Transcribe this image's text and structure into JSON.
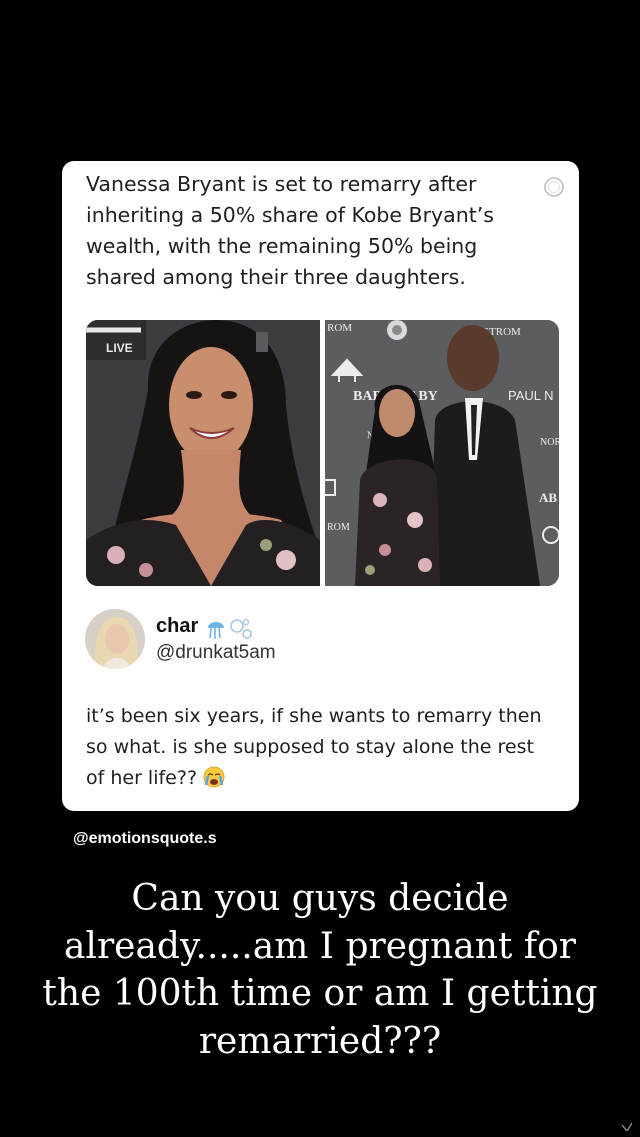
{
  "post": {
    "headline": "Vanessa Bryant is set to remarry after inheriting a 50% share of Kobe Bryant’s wealth, with the remaining 50% being shared among their three daughters.",
    "photo_left": {
      "backdrop_text": "LIVE"
    },
    "photo_right": {
      "backdrop_texts": [
        "ROM",
        "DSTROM",
        "BABY2BABY",
        "PAUL N",
        "NOR",
        "AB",
        "ROM",
        "N"
      ]
    }
  },
  "reply": {
    "user_name": "char",
    "user_handle": "@drunkat5am",
    "text": "it’s been six years, if she wants to remarry then so what. is she supposed to stay alone the rest of her life??",
    "emoji": "crying-face"
  },
  "watermark": "@emotionsquote.s",
  "caption": "Can you guys decide already.....am I pregnant for the 100th time or am I getting remarried???"
}
